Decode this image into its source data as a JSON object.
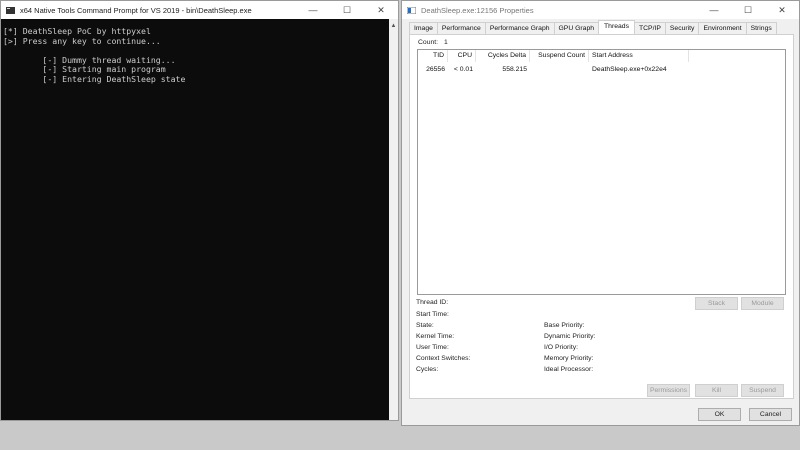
{
  "console": {
    "title": "x64 Native Tools Command Prompt for VS 2019 - bin\\DeathSleep.exe",
    "lines": [
      "[*] DeathSleep PoC by httpyxel",
      "[>] Press any key to continue...",
      "",
      "        [-] Dummy thread waiting...",
      "        [-] Starting main program",
      "        [-] Entering DeathSleep state"
    ]
  },
  "window_controls": {
    "minimize": "—",
    "maximize": "☐",
    "close": "✕"
  },
  "properties": {
    "title": "DeathSleep.exe:12156 Properties",
    "tabs": [
      "Image",
      "Performance",
      "Performance Graph",
      "GPU Graph",
      "Threads",
      "TCP/IP",
      "Security",
      "Environment",
      "Strings"
    ],
    "selected_tab": "Threads",
    "count_label": "Count:",
    "count_value": "1",
    "columns": [
      "TID",
      "CPU",
      "Cycles Delta",
      "Suspend Count",
      "Start Address"
    ],
    "rows": [
      [
        "26556",
        "< 0.01",
        "558.215",
        "",
        "DeathSleep.exe+0x22e4"
      ]
    ],
    "fields_left": [
      "Thread ID:",
      "Start Time:",
      "State:",
      "Kernel Time:",
      "User Time:",
      "Context Switches:",
      "Cycles:"
    ],
    "fields_right": [
      "Base Priority:",
      "Dynamic Priority:",
      "I/O Priority:",
      "Memory Priority:",
      "Ideal Processor:"
    ],
    "buttons": {
      "stack": "Stack",
      "module": "Module",
      "permissions": "Permissions",
      "kill": "Kill",
      "suspend": "Suspend",
      "ok": "OK",
      "cancel": "Cancel"
    }
  }
}
